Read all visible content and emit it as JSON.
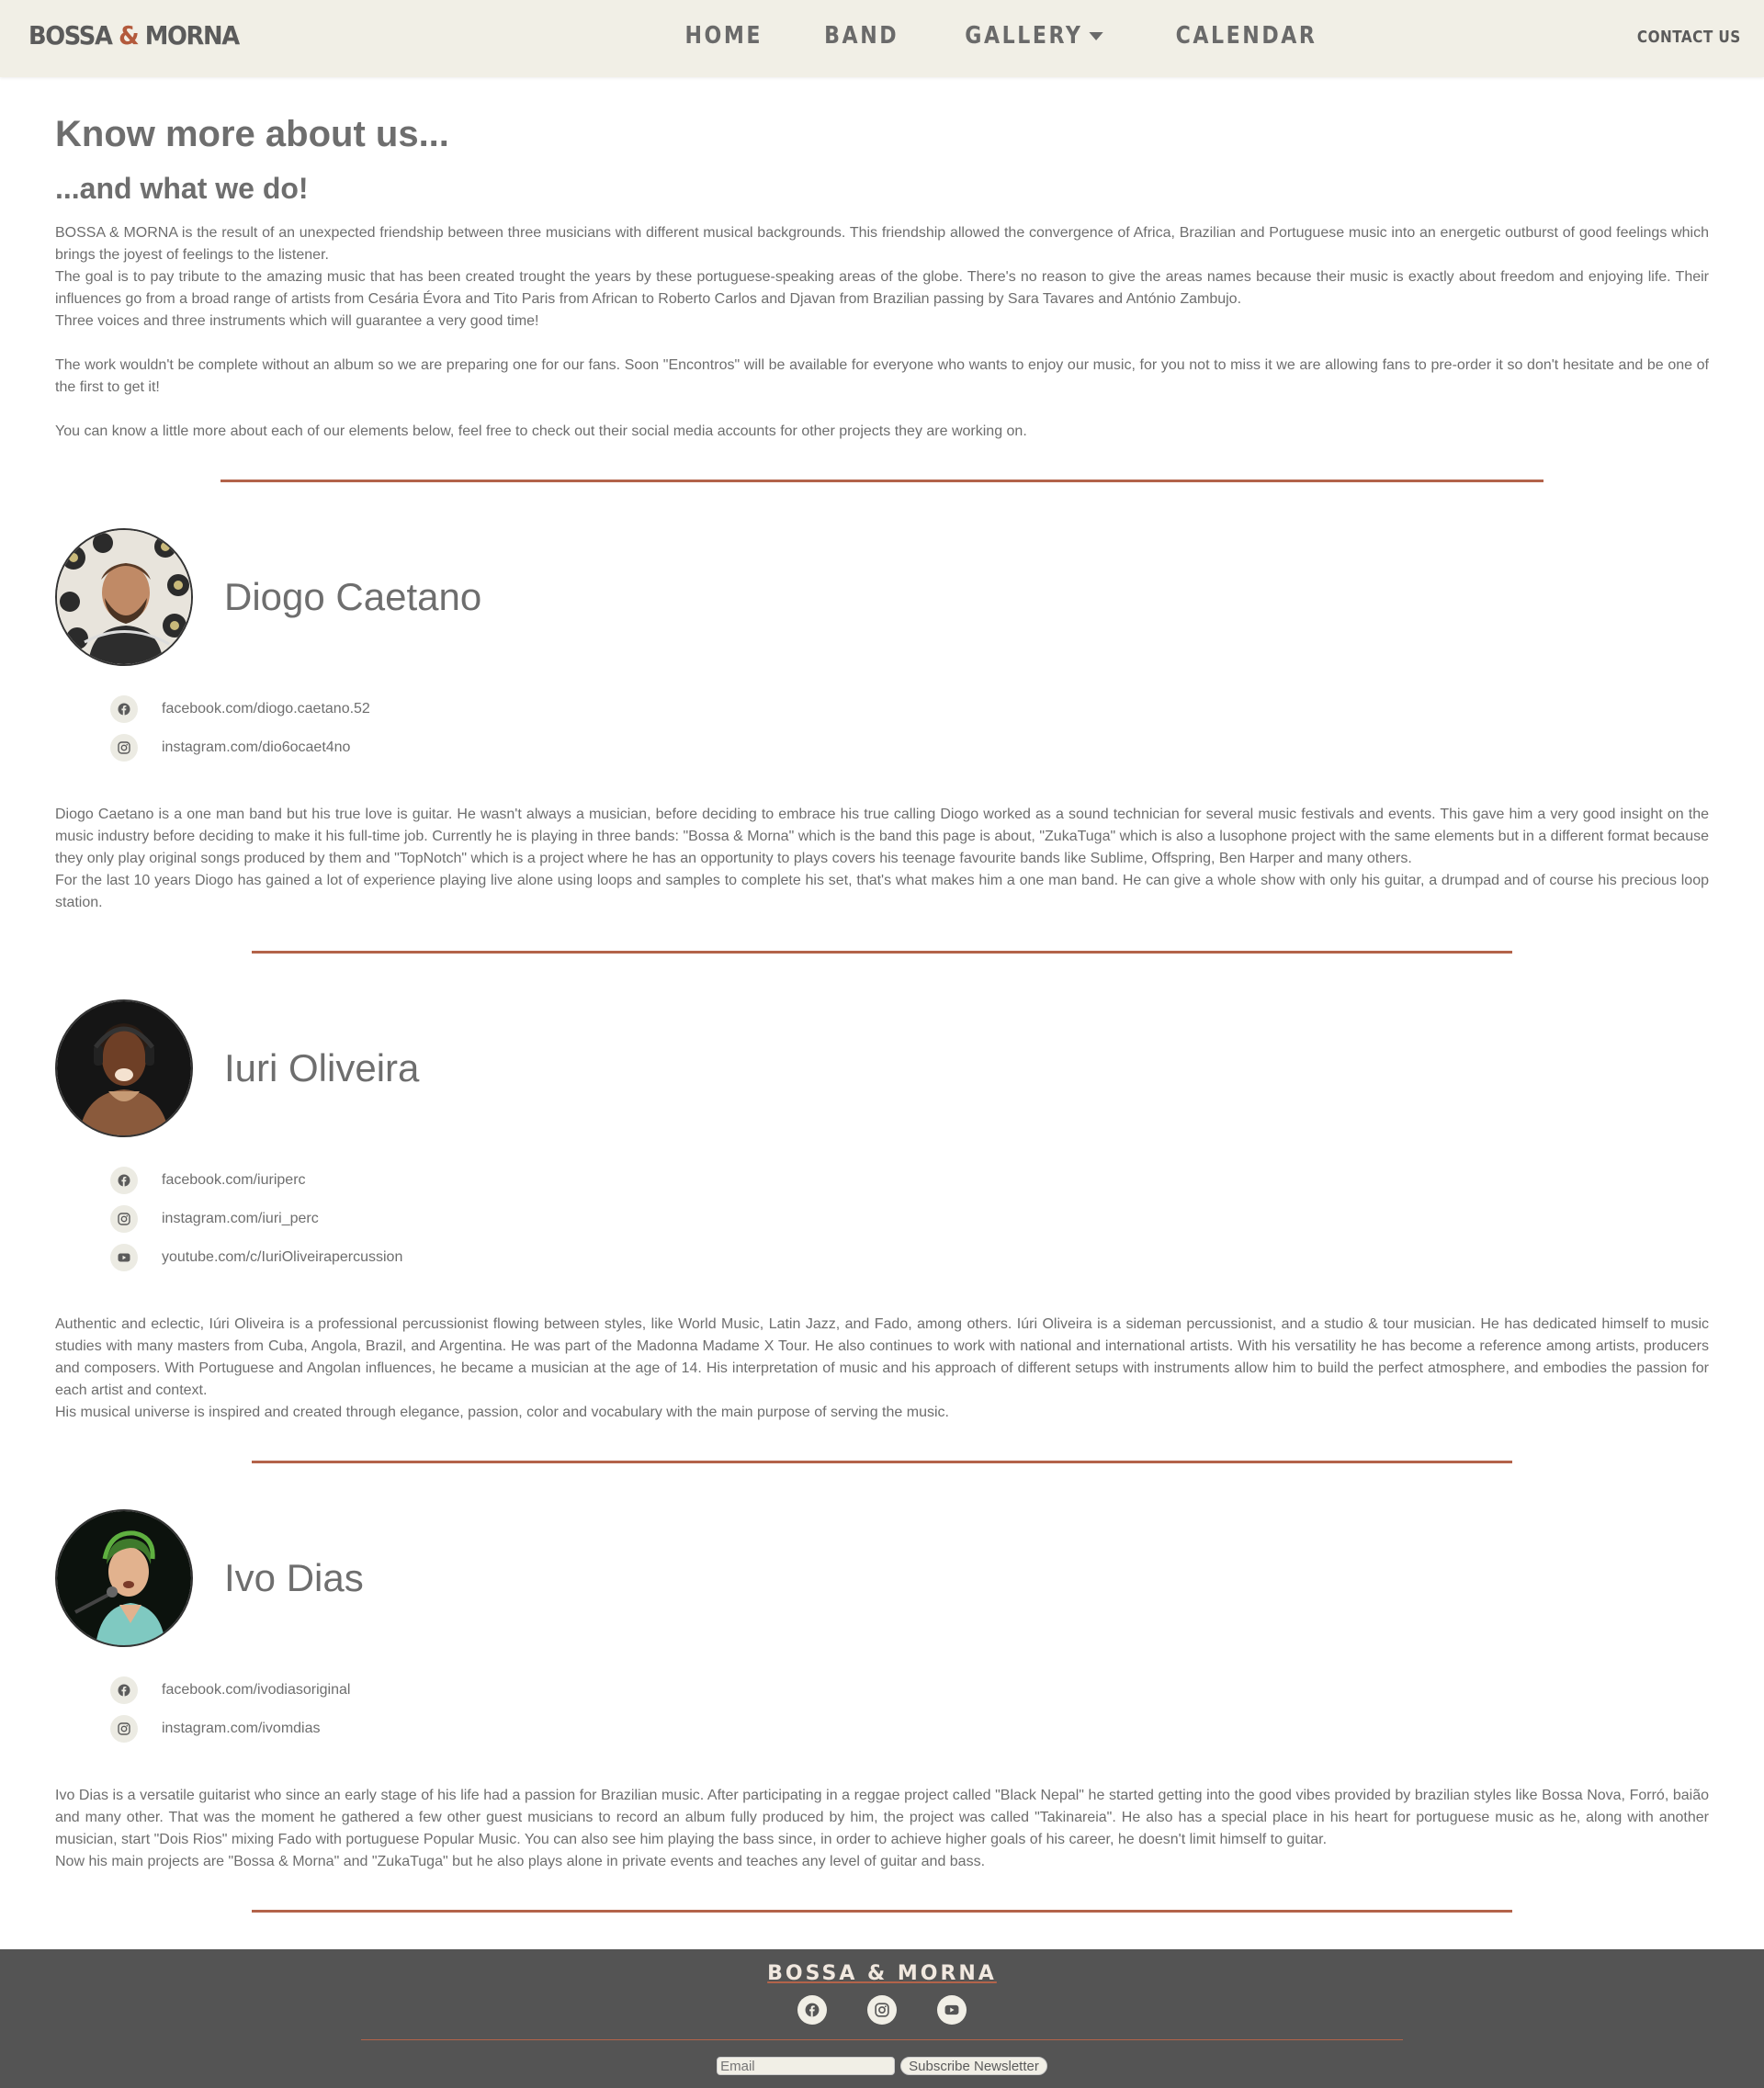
{
  "header": {
    "brand": {
      "part1": "BOSSA ",
      "amp": "&",
      "part2": " MORNA"
    },
    "nav": {
      "home": "HOME",
      "band": "BAND",
      "gallery": "GALLERY",
      "calendar": "CALENDAR"
    },
    "contact": "CONTACT US"
  },
  "intro": {
    "title": "Know more about us...",
    "subtitle": "...and what we do!",
    "p1": "BOSSA & MORNA is the result of an unexpected friendship between three musicians with different musical backgrounds. This friendship allowed the convergence of Africa, Brazilian and Portuguese music into an energetic outburst of good feelings which brings the joyest of feelings to the listener.",
    "p2": "The goal is to pay tribute to the amazing music that has been created trought the years by these portuguese-speaking areas of the globe. There's no reason to give the areas names because their music is exactly about freedom and enjoying life. Their influences go from a broad range of artists from Cesária Évora and Tito Paris from African to Roberto Carlos and Djavan from Brazilian passing by Sara Tavares and António Zambujo.",
    "p3": "Three voices and three instruments which will guarantee a very good time!",
    "p4": "The work wouldn't be complete without an album so we are preparing one for our fans. Soon \"Encontros\" will be available for everyone who wants to enjoy our music, for you not to miss it we are allowing fans to pre-order it so don't hesitate and be one of the first to get it!",
    "p5": "You can know a little more about each of our elements below, feel free to check out their social media accounts for other projects they are working on."
  },
  "members": [
    {
      "name": "Diogo Caetano",
      "socials": [
        {
          "icon": "facebook-icon",
          "text": "facebook.com/diogo.caetano.52"
        },
        {
          "icon": "instagram-icon",
          "text": "instagram.com/dio6ocaet4no"
        }
      ],
      "bio": [
        "Diogo Caetano is a one man band but his true love is guitar. He wasn't always a musician, before deciding to embrace his true calling Diogo worked as a sound technician for several music festivals and events. This gave him a very good insight on the music industry before deciding to make it his full-time job. Currently he is playing in three bands: \"Bossa & Morna\" which is the band this page is about, \"ZukaTuga\" which is also a lusophone project with the same elements but in a different format because they only play original songs produced by them and \"TopNotch\" which is a project where he has an opportunity to plays covers his teenage favourite bands like Sublime, Offspring, Ben Harper and many others.",
        "For the last 10 years Diogo has gained a lot of experience playing live alone using loops and samples to complete his set, that's what makes him a one man band. He can give a whole show with only his guitar, a drumpad and of course his precious loop station."
      ]
    },
    {
      "name": "Iuri Oliveira",
      "socials": [
        {
          "icon": "facebook-icon",
          "text": "facebook.com/iuriperc"
        },
        {
          "icon": "instagram-icon",
          "text": "instagram.com/iuri_perc"
        },
        {
          "icon": "youtube-icon",
          "text": "youtube.com/c/IuriOliveirapercussion"
        }
      ],
      "bio": [
        "Authentic and eclectic, Iúri Oliveira is a professional percussionist flowing between styles, like World Music, Latin Jazz, and Fado, among others. Iúri Oliveira is a sideman percussionist, and a studio & tour musician. He has dedicated himself to music studies with many masters from Cuba, Angola, Brazil, and Argentina. He was part of the Madonna Madame X Tour. He also continues to work with national and international artists. With his versatility he has become a reference among artists, producers and composers. With Portuguese and Angolan influences, he became a musician at the age of 14. His interpretation of music and his approach of different setups with instruments allow him to build the perfect atmosphere, and embodies the passion for each artist and context.",
        "His musical universe is inspired and created through elegance, passion, color and vocabulary with the main purpose of serving the music."
      ]
    },
    {
      "name": "Ivo Dias",
      "socials": [
        {
          "icon": "facebook-icon",
          "text": "facebook.com/ivodiasoriginal"
        },
        {
          "icon": "instagram-icon",
          "text": "instagram.com/ivomdias"
        }
      ],
      "bio": [
        "Ivo Dias is a versatile guitarist who since an early stage of his life had a passion for Brazilian music. After participating in a reggae project called \"Black Nepal\" he started getting into the good vibes provided by brazilian styles like Bossa Nova, Forró, baião and many other. That was the moment he gathered a few other guest musicians to record an album fully produced by him, the project was called \"Takinareia\". He also has a special place in his heart for portuguese music as he, along with another musician, start \"Dois Rios\" mixing Fado with portuguese Popular Music. You can also see him playing the bass since, in order to achieve higher goals of his career, he doesn't limit himself to guitar.",
        "Now his main projects are \"Bossa & Morna\" and \"ZukaTuga\" but he also plays alone in private events and teaches any level of guitar and bass."
      ]
    }
  ],
  "footer": {
    "brand": "BOSSA & MORNA",
    "social_icons": [
      "facebook-icon",
      "instagram-icon",
      "youtube-icon"
    ],
    "email_placeholder": "Email",
    "subscribe_label": "Subscribe Newsletter"
  },
  "colors": {
    "nav_bg": "#f1efe6",
    "accent": "#b3634a",
    "text": "#6e6e6e",
    "footer_bg": "#545454"
  }
}
